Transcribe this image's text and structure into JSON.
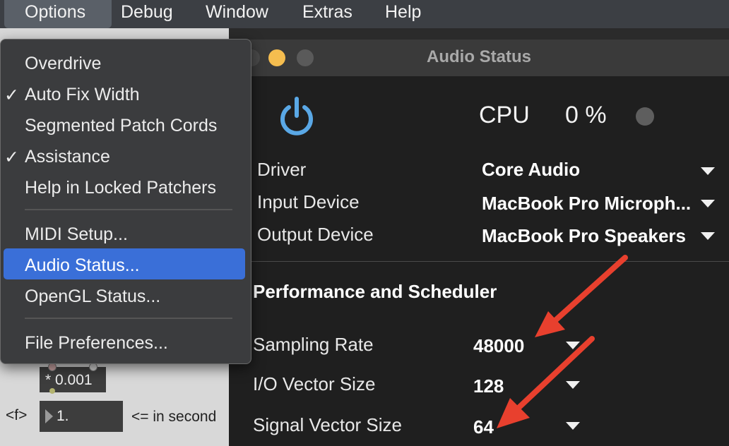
{
  "menubar": {
    "items": [
      "Options",
      "Debug",
      "Window",
      "Extras",
      "Help"
    ]
  },
  "options_menu": {
    "items": [
      {
        "label": "Overdrive",
        "checked": false
      },
      {
        "label": "Auto Fix Width",
        "checked": true
      },
      {
        "label": "Segmented Patch Cords",
        "checked": false
      },
      {
        "label": "Assistance",
        "checked": true
      },
      {
        "label": "Help in Locked Patchers",
        "checked": false
      },
      {
        "label": "MIDI Setup...",
        "checked": false
      },
      {
        "label": "Audio Status...",
        "checked": false,
        "highlighted": true
      },
      {
        "label": "OpenGL Status...",
        "checked": false
      },
      {
        "label": "File Preferences...",
        "checked": false
      }
    ],
    "check_glyph": "✓"
  },
  "patcher": {
    "multiply_object": "* 0.001",
    "f_label": "<f>",
    "number_value": "1.",
    "comment": "<= in second"
  },
  "audio_status": {
    "title": "Audio Status",
    "cpu_label": "CPU",
    "cpu_value": "0 %",
    "rows": [
      {
        "label": "Driver",
        "value": "Core Audio"
      },
      {
        "label": "Input Device",
        "value": "MacBook Pro Microph..."
      },
      {
        "label": "Output Device",
        "value": "MacBook Pro Speakers"
      }
    ],
    "section_title": "Performance and Scheduler",
    "perf_rows": [
      {
        "label": "Sampling Rate",
        "value": "48000"
      },
      {
        "label": "I/O Vector Size",
        "value": "128"
      },
      {
        "label": "Signal Vector Size",
        "value": "64"
      }
    ]
  },
  "colors": {
    "power_icon": "#5aa8e6",
    "menu_highlight": "#3a6fd8",
    "annotation_arrow": "#e8402e"
  }
}
